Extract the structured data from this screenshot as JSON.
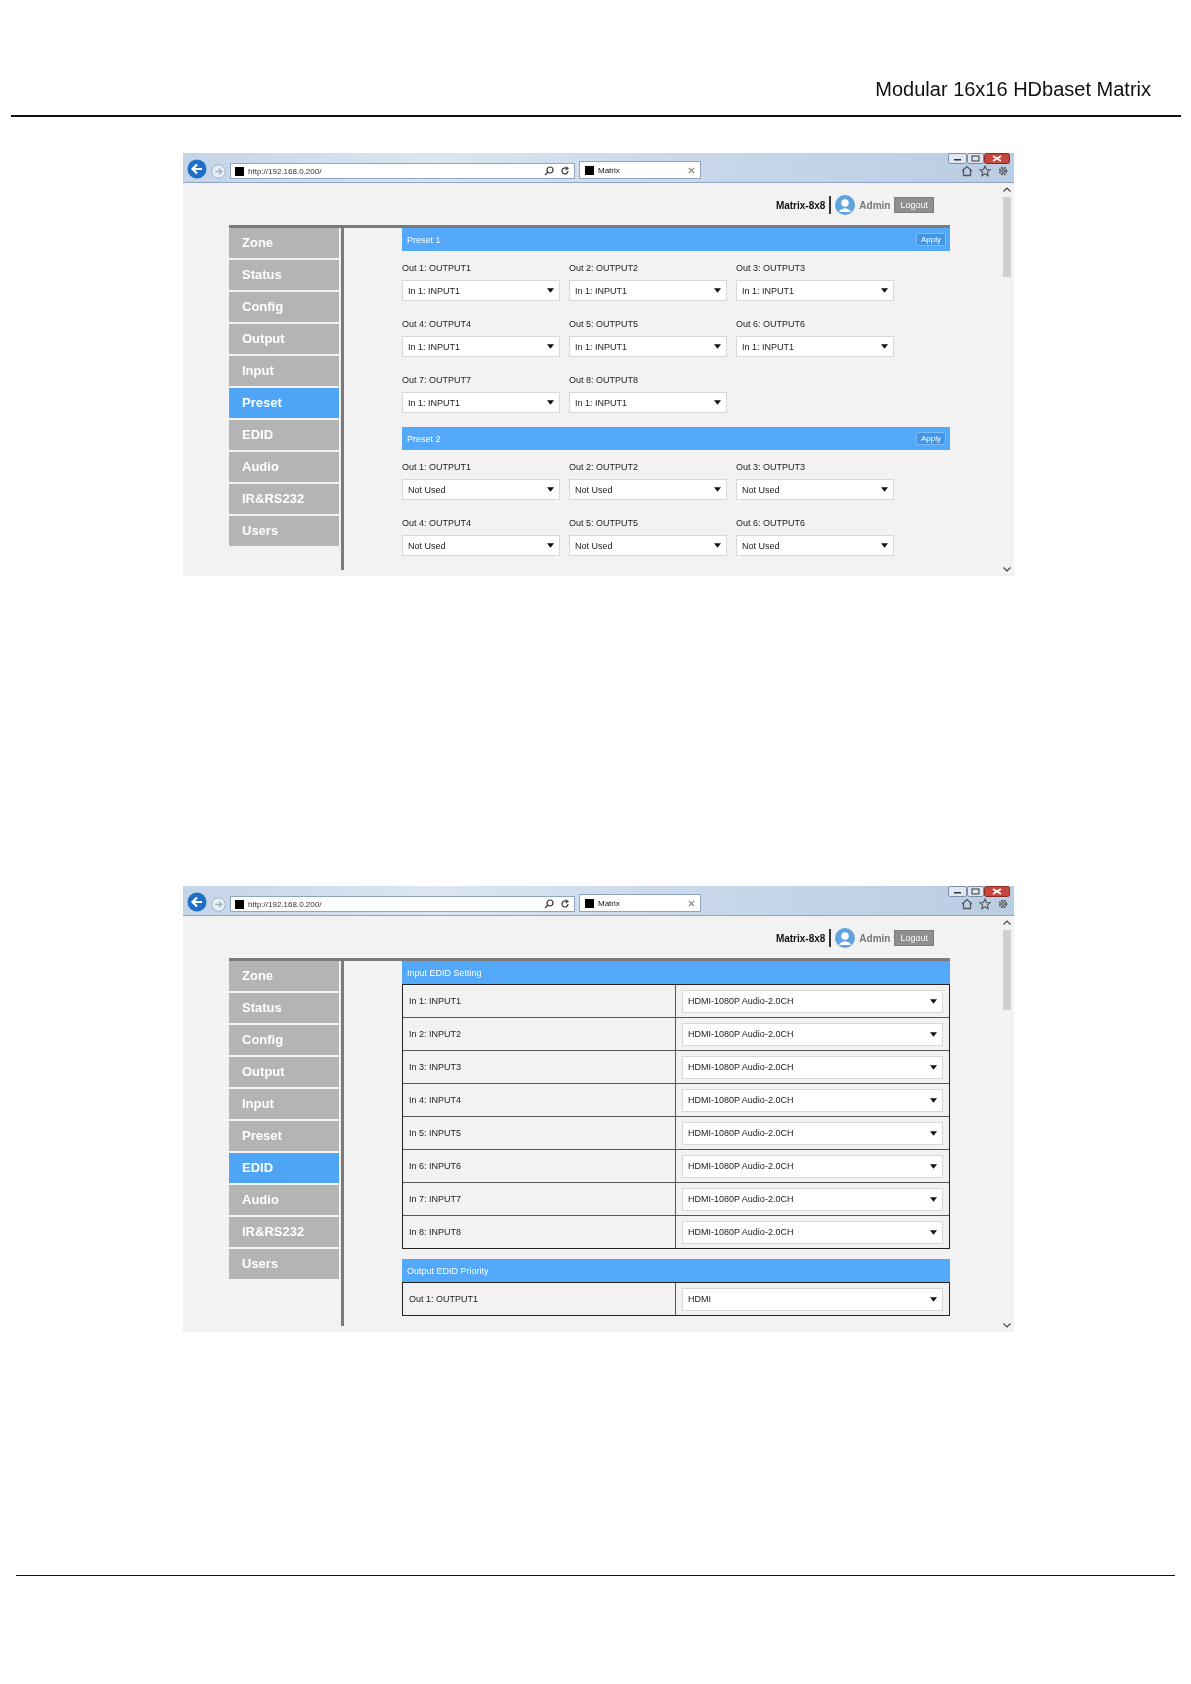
{
  "document": {
    "header": "Modular 16x16 HDbaset Matrix"
  },
  "screenshots": [
    {
      "browser": {
        "address": "http://192.168.0.200/",
        "tab": "Matrix"
      },
      "device": "Matrix-8x8",
      "user": "Admin",
      "logout": "Logout",
      "nav": [
        {
          "label": "Zone",
          "selected": false
        },
        {
          "label": "Status",
          "selected": false
        },
        {
          "label": "Config",
          "selected": false
        },
        {
          "label": "Output",
          "selected": false
        },
        {
          "label": "Input",
          "selected": false
        },
        {
          "label": "Preset",
          "selected": true
        },
        {
          "label": "EDID",
          "selected": false
        },
        {
          "label": "Audio",
          "selected": false
        },
        {
          "label": "IR&RS232",
          "selected": false
        },
        {
          "label": "Users",
          "selected": false
        }
      ],
      "panels": [
        {
          "kind": "preset",
          "title": "Preset 1",
          "apply": "Apply",
          "fields": [
            {
              "label": "Out 1: OUTPUT1",
              "value": "In 1: INPUT1"
            },
            {
              "label": "Out 2: OUTPUT2",
              "value": "In 1: INPUT1"
            },
            {
              "label": "Out 3: OUTPUT3",
              "value": "In 1: INPUT1"
            },
            {
              "label": "Out 4: OUTPUT4",
              "value": "In 1: INPUT1"
            },
            {
              "label": "Out 5: OUTPUT5",
              "value": "In 1: INPUT1"
            },
            {
              "label": "Out 6: OUTPUT6",
              "value": "In 1: INPUT1"
            },
            {
              "label": "Out 7: OUTPUT7",
              "value": "In 1: INPUT1"
            },
            {
              "label": "Out 8: OUTPUT8",
              "value": "In 1: INPUT1"
            }
          ]
        },
        {
          "kind": "preset",
          "title": "Preset 2",
          "apply": "Apply",
          "fields": [
            {
              "label": "Out 1: OUTPUT1",
              "value": "Not Used"
            },
            {
              "label": "Out 2: OUTPUT2",
              "value": "Not Used"
            },
            {
              "label": "Out 3: OUTPUT3",
              "value": "Not Used"
            },
            {
              "label": "Out 4: OUTPUT4",
              "value": "Not Used"
            },
            {
              "label": "Out 5: OUTPUT5",
              "value": "Not Used"
            },
            {
              "label": "Out 6: OUTPUT6",
              "value": "Not Used"
            }
          ]
        }
      ]
    },
    {
      "browser": {
        "address": "http://192.168.0.200/",
        "tab": "Matrix"
      },
      "device": "Matrix-8x8",
      "user": "Admin",
      "logout": "Logout",
      "nav": [
        {
          "label": "Zone",
          "selected": false
        },
        {
          "label": "Status",
          "selected": false
        },
        {
          "label": "Config",
          "selected": false
        },
        {
          "label": "Output",
          "selected": false
        },
        {
          "label": "Input",
          "selected": false
        },
        {
          "label": "Preset",
          "selected": false
        },
        {
          "label": "EDID",
          "selected": true
        },
        {
          "label": "Audio",
          "selected": false
        },
        {
          "label": "IR&RS232",
          "selected": false
        },
        {
          "label": "Users",
          "selected": false
        }
      ],
      "panels": [
        {
          "kind": "table",
          "title": "Input EDID Setting",
          "rows": [
            {
              "label": "In 1: INPUT1",
              "value": "HDMI-1080P Audio-2.0CH"
            },
            {
              "label": "In 2: INPUT2",
              "value": "HDMI-1080P Audio-2.0CH"
            },
            {
              "label": "In 3: INPUT3",
              "value": "HDMI-1080P Audio-2.0CH"
            },
            {
              "label": "In 4: INPUT4",
              "value": "HDMI-1080P Audio-2.0CH"
            },
            {
              "label": "In 5: INPUT5",
              "value": "HDMI-1080P Audio-2.0CH"
            },
            {
              "label": "In 6: INPUT6",
              "value": "HDMI-1080P Audio-2.0CH"
            },
            {
              "label": "In 7: INPUT7",
              "value": "HDMI-1080P Audio-2.0CH"
            },
            {
              "label": "In 8: INPUT8",
              "value": "HDMI-1080P Audio-2.0CH"
            }
          ]
        },
        {
          "kind": "table",
          "title": "Output EDID Priority",
          "rows": [
            {
              "label": "Out 1: OUTPUT1",
              "value": "HDMI"
            }
          ]
        }
      ]
    }
  ]
}
